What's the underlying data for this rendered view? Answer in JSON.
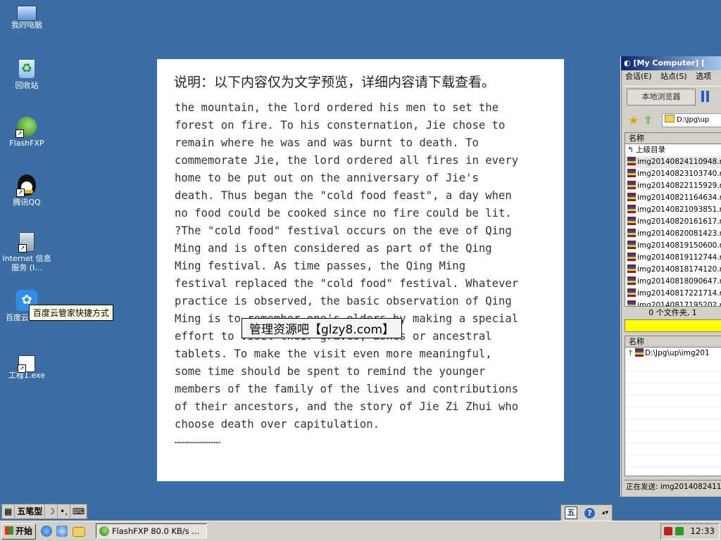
{
  "desktop": {
    "icons": [
      {
        "label": "我的电脑"
      },
      {
        "label": "回收站"
      },
      {
        "label": "FlashFXP"
      },
      {
        "label": "腾讯QQ"
      },
      {
        "label": "Internet 信息服务 (I..."
      },
      {
        "label": "百度云"
      },
      {
        "label": "工程1.exe"
      }
    ],
    "tooltip": "百度云管家快捷方式"
  },
  "preview": {
    "heading": "说明：以下内容仅为文字预览，详细内容请下载查看。",
    "lines": [
      "the mountain, the lord ordered his men to set the",
      "forest on fire. To his consternation, Jie chose to",
      "remain where he was and was burnt to death. To",
      "commemorate Jie, the lord ordered all fires in every",
      "home to be put out on the anniversary of Jie's",
      "death. Thus began the \"cold food feast\", a day when",
      "no food could be cooked since no fire could be lit.",
      "?The \"cold food\" festival occurs on the eve of Qing",
      "Ming and is often considered as part of the Qing",
      "Ming festival. As time passes, the Qing Ming",
      "festival replaced the \"cold food\" festival. Whatever",
      "practice is observed, the basic observation of Qing",
      "Ming is to remember one's elders by making a special",
      "effort to visit their graves, ashes or ancestral",
      "tablets. To make the visit even more meaningful,",
      "some time should be spent to remind the younger",
      "members of the family of the lives and contributions",
      "of their ancestors, and the story of Jie Zi Zhui who",
      "choose death over capitulation.",
      "………………………"
    ],
    "watermark": "管理资源吧【glzy8.com】"
  },
  "flashfxp": {
    "title": "[My Computer]  [",
    "menu": [
      "会话(E)",
      "站点(S)",
      "选项"
    ],
    "browse_label": "本地浏览器",
    "path": "D:\\Jpg\\up",
    "column_name": "名称",
    "parent_dir": "上级目录",
    "files": [
      "img20140824110948.r",
      "img20140823103740.r",
      "img20140822115929.r",
      "img20140821164634.r",
      "img20140821093851.r",
      "img20140820161617.r",
      "img20140820081423.r",
      "img20140819150600.r",
      "img20140819112744.r",
      "img20140818174120.r",
      "img20140818090647.r",
      "img20140817221714.r",
      "img20140817195202.r"
    ],
    "file_count": "0 个文件夹, 1",
    "queue_column_name": "名称",
    "queue_item": "D:\\Jpg\\up\\img201",
    "sending_status": "正在发送: img2014082411"
  },
  "ime": {
    "mode": "五笔型",
    "moon": "☽",
    "punct": "•,"
  },
  "langbar": {
    "wu": "五",
    "help": "?"
  },
  "taskbar": {
    "start_label": "开始",
    "task_label": "FlashFXP 80.0 KB/s ...",
    "clock": "12:33"
  }
}
